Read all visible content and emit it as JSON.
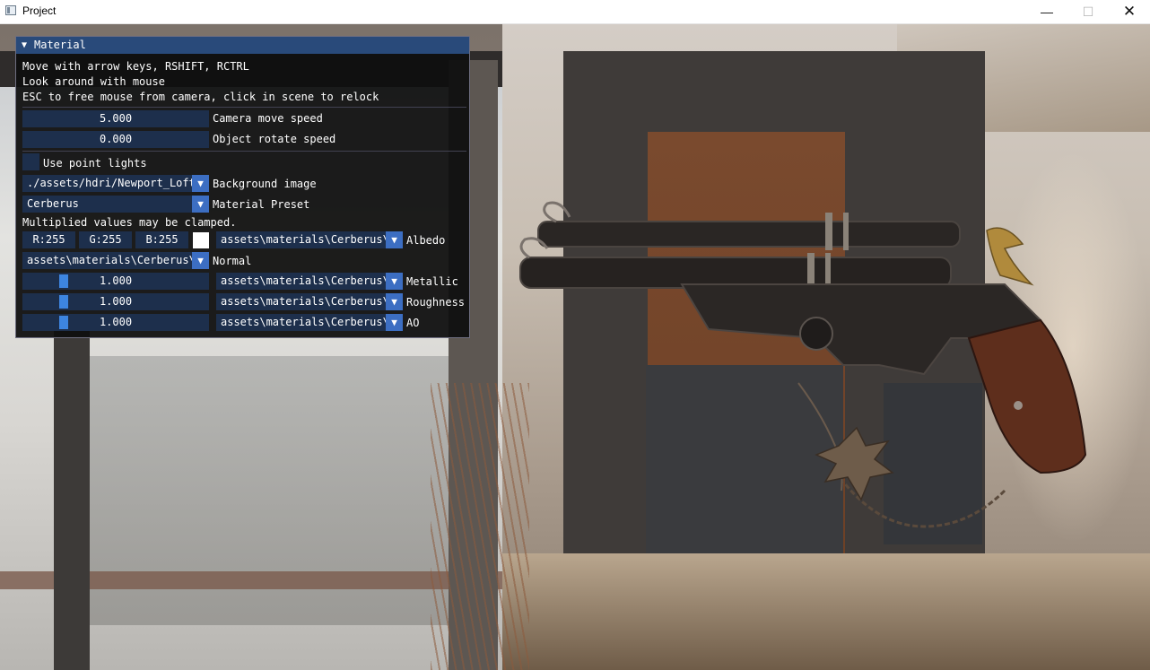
{
  "window": {
    "title": "Project",
    "minimize_glyph": "—",
    "maximize_glyph": "☐",
    "close_glyph": "✕"
  },
  "panel": {
    "title": "Material",
    "collapse_glyph": "▼",
    "help_lines": [
      "Move with arrow keys, RSHIFT, RCTRL",
      "Look around with mouse",
      "ESC to free mouse from camera, click in scene to relock"
    ],
    "camera_speed": {
      "value": "5.000",
      "label": "Camera move speed"
    },
    "rotate_speed": {
      "value": "0.000",
      "label": "Object rotate speed"
    },
    "point_lights": {
      "label": "Use point lights",
      "checked": false
    },
    "background": {
      "value": "./assets/hdri/Newport_Loft_",
      "label": "Background image"
    },
    "preset": {
      "value": "Cerberus",
      "label": "Material Preset"
    },
    "clamp_note": "Multiplied values may be clamped.",
    "albedo": {
      "r": "R:255",
      "g": "G:255",
      "b": "B:255",
      "swatch_color": "#ffffff",
      "texture": "assets\\materials\\Cerberus\\(",
      "label": "Albedo"
    },
    "normal": {
      "texture": "assets\\materials\\Cerberus\\(",
      "label": "Normal"
    },
    "metallic": {
      "value": "1.000",
      "fraction": 1.0,
      "texture": "assets\\materials\\Cerberus\\(",
      "label": "Metallic"
    },
    "roughness": {
      "value": "1.000",
      "fraction": 1.0,
      "texture": "assets\\materials\\Cerberus\\(",
      "label": "Roughness"
    },
    "ao": {
      "value": "1.000",
      "fraction": 1.0,
      "texture": "assets\\materials\\Cerberus\\(",
      "label": "AO"
    },
    "combo_arrow_glyph": "▼"
  },
  "colors": {
    "panel_bg": "#0f0f0f",
    "title_bg": "#294a7a",
    "frame_bg": "#1d2f4c",
    "button_accent": "#3c6ec2",
    "slider_grab": "#3d85e0"
  }
}
